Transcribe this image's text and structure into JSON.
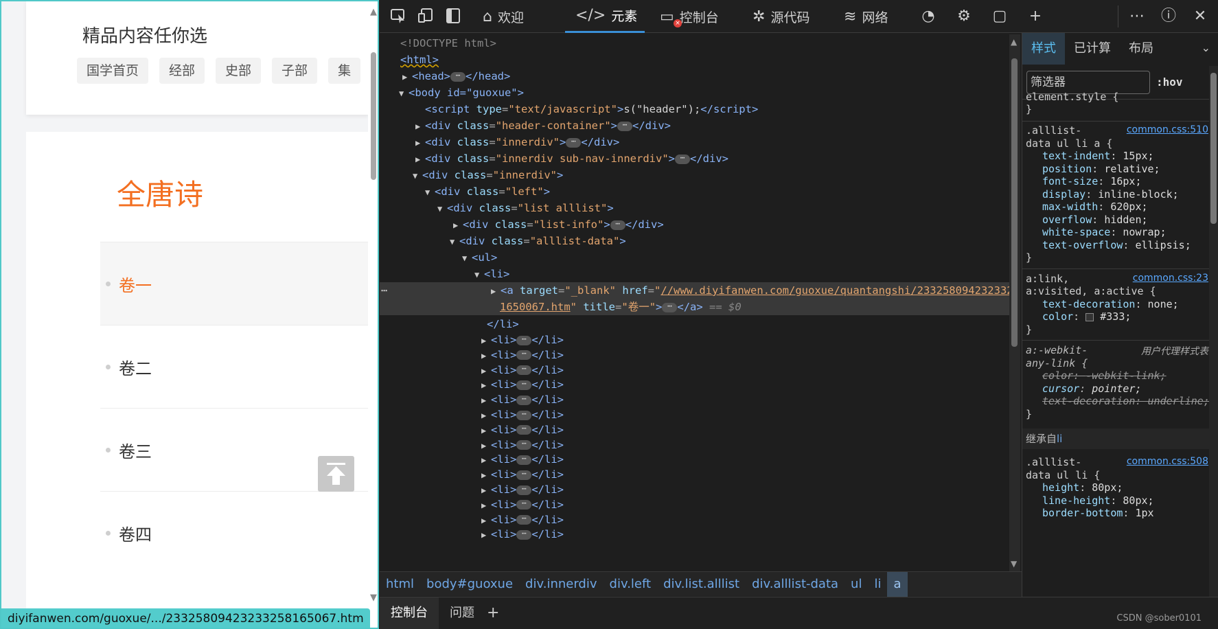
{
  "page": {
    "header_title": "精品内容任你选",
    "categories": [
      "国学首页",
      "经部",
      "史部",
      "子部",
      "集"
    ],
    "big_title": "全唐诗",
    "volumes": [
      "卷一",
      "卷二",
      "卷三",
      "卷四"
    ],
    "status_url": "diyifanwen.com/guoxue/.../23325809423233258165067.htm"
  },
  "devtools": {
    "tabs": {
      "welcome": "欢迎",
      "elements": "元素",
      "console": "控制台",
      "sources": "源代码",
      "network": "网络"
    },
    "tree": {
      "doctype": "<!DOCTYPE html>",
      "html_tag": "<html>",
      "head_open": "<head>",
      "head_close": "</head>",
      "body_open": "<body id=\"guoxue\">",
      "script_attr_name": "type",
      "script_attr_value": "\"text/javascript\"",
      "script_text": "s(\"header\");",
      "div1_class": "\"header-container\"",
      "div2_class": "\"innerdiv\"",
      "div3_class": "\"innerdiv  sub-nav-innerdiv\"",
      "div4_class": "\"innerdiv\"",
      "div5_class": "\"left\"",
      "div6_class": "\"list alllist\"",
      "div7_class": "\"list-info\"",
      "div8_class": "\"alllist-data\"",
      "a_target": "\"_blank\"",
      "a_href_1": "//www.diyifanwen.com/guoxue/quantangshi/23325809423233258",
      "a_href_2": "1650067.htm",
      "a_title": "\"卷一\"",
      "a_eq": "== $0",
      "li_close": "</li>",
      "collapsed_li_count": 14
    },
    "breadcrumbs": [
      "html",
      "body#guoxue",
      "div.innerdiv",
      "div.left",
      "div.list.alllist",
      "div.alllist-data",
      "ul",
      "li",
      "a"
    ],
    "drawer": {
      "console": "控制台",
      "issues": "问题"
    },
    "watermark": "CSDN @sober0101",
    "styles": {
      "tabs": [
        "样式",
        "已计算",
        "布局"
      ],
      "filter_placeholder": "筛选器",
      "hov": ":hov",
      "element_style": "element.style {",
      "close_brace": "}",
      "rule1": {
        "sel1": ".alllist-",
        "sel2": "data ul li a {",
        "src": "common.css:510",
        "props": [
          [
            "text-indent",
            "15px;"
          ],
          [
            "position",
            "relative;"
          ],
          [
            "font-size",
            "16px;"
          ],
          [
            "display",
            "inline-block;"
          ],
          [
            "max-width",
            "620px;"
          ],
          [
            "overflow",
            "hidden;"
          ],
          [
            "white-space",
            "nowrap;"
          ],
          [
            "text-overflow",
            "ellipsis;"
          ]
        ]
      },
      "rule2": {
        "sel1": "a:link,",
        "sel2": "a:visited, a:active {",
        "src": "common.css:23",
        "props": [
          [
            "text-decoration",
            "none;"
          ],
          [
            "color",
            "#333;"
          ]
        ]
      },
      "rule3": {
        "sel1": "a:-webkit-",
        "sel2": "any-link {",
        "src": "用户代理样式表",
        "props": [
          [
            "color",
            "-webkit-link;"
          ],
          [
            "cursor",
            "pointer;"
          ],
          [
            "text-decoration",
            "underline;"
          ]
        ]
      },
      "inherited": "继承自",
      "inherited_tag": "li",
      "rule4": {
        "sel1": ".alllist-",
        "sel2": "data ul li {",
        "src": "common.css:508",
        "props": [
          [
            "height",
            "80px;"
          ],
          [
            "line-height",
            "80px;"
          ],
          [
            "border-bottom",
            "1px"
          ]
        ]
      }
    }
  },
  "colors": {
    "accent": "#f36f21",
    "devtools_bg": "#1e1e1e",
    "selection": "#3a8fd6"
  }
}
